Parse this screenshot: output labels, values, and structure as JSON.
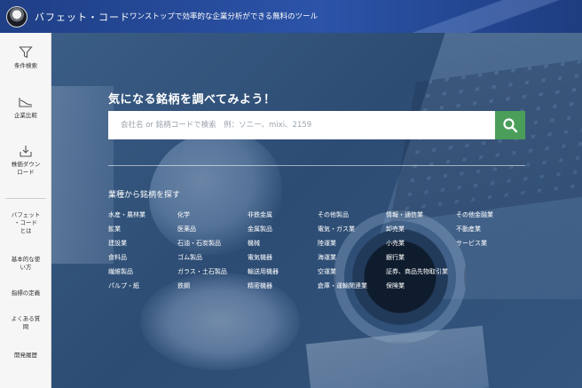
{
  "header": {
    "site_name": "バフェット・コード",
    "tagline": "ワンストップで効率的な企業分析ができる無料のツール"
  },
  "sidebar": {
    "items": [
      {
        "label": "条件検索",
        "icon": "filter-icon"
      },
      {
        "label": "企業比較",
        "icon": "compare-chart-icon"
      },
      {
        "label": "株価ダウン\nロード",
        "icon": "download-icon"
      }
    ],
    "links": [
      "バフェット\n・コード\nとは",
      "基本的な使\nい方",
      "指標の定義",
      "よくある質\n問",
      "開発履歴"
    ]
  },
  "hero": {
    "title": "気になる銘柄を調べてみよう！",
    "search_placeholder": "会社名 or 銘柄コードで検索　例：ソニー、mixi、2159",
    "search_value": "",
    "categories_title": "業種から銘柄を探す",
    "categories": [
      [
        "水産・農林業",
        "鉱業",
        "建設業",
        "食料品",
        "繊維製品",
        "パルプ・紙"
      ],
      [
        "化学",
        "医薬品",
        "石油・石炭製品",
        "ゴム製品",
        "ガラス・土石製品",
        "鉄鋼"
      ],
      [
        "非鉄金属",
        "金属製品",
        "機械",
        "電気機器",
        "輸送用機器",
        "精密機器"
      ],
      [
        "その他製品",
        "電気・ガス業",
        "陸運業",
        "海運業",
        "空運業",
        "倉庫・運輸関連業"
      ],
      [
        "情報・通信業",
        "卸売業",
        "小売業",
        "銀行業",
        "証券、商品先物取引業",
        "保険業"
      ],
      [
        "その他金融業",
        "不動産業",
        "サービス業"
      ]
    ]
  },
  "colors": {
    "header": "#2b53a8",
    "search_button": "#4a9e5a",
    "sidebar_bg": "#f6f6f6"
  }
}
